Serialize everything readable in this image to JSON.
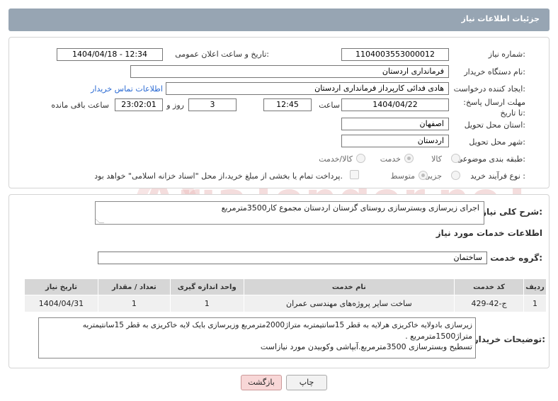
{
  "header": {
    "title": "جزئیات اطلاعات نیاز"
  },
  "fields": {
    "need_number_label": "شماره نیاز:",
    "need_number": "1104003553000012",
    "announce_label": "تاریخ و ساعت اعلان عمومی:",
    "announce_value": "1404/04/18 - 12:34",
    "buyer_org_label": "نام دستگاه خریدار:",
    "buyer_org": "فرمانداری اردستان",
    "creator_label": "ایجاد کننده درخواست:",
    "creator": "هادی فدائی کارپرداز فرمانداری اردستان",
    "contact_link": "اطلاعات تماس خریدار",
    "deadline_label": "مهلت ارسال پاسخ: تا تاریخ:",
    "deadline_date": "1404/04/22",
    "time_label": "ساعت",
    "deadline_time": "12:45",
    "days_value": "3",
    "days_label": "روز و",
    "remaining_time": "23:02:01",
    "remaining_label": "ساعت باقی مانده",
    "province_label": "استان محل تحویل:",
    "province": "اصفهان",
    "city_label": "شهر محل تحویل:",
    "city": "اردستان",
    "category_label": "طبقه بندی موضوعی:",
    "category_options": [
      "کالا",
      "خدمت",
      "کالا/خدمت"
    ],
    "process_label": "نوع فرآیند خرید :",
    "process_options": [
      "جزیی",
      "متوسط"
    ],
    "payment_note": "پرداخت تمام یا بخشی از مبلغ خرید،از محل \"اسناد خزانه اسلامی\" خواهد بود."
  },
  "summary": {
    "label": "شرح کلی نیاز:",
    "text": "اجرای زیرسازی وبسترسازی روستای گزستان اردستان مجموع کار3500مترمربع"
  },
  "services": {
    "title": "اطلاعات خدمات مورد نیاز",
    "group_label": "گروه خدمت:",
    "group_value": "ساختمان",
    "columns": [
      "ردیف",
      "کد خدمت",
      "نام خدمت",
      "واحد اندازه گیری",
      "تعداد / مقدار",
      "تاریخ نیاز"
    ],
    "rows": [
      [
        "1",
        "ج-42-429",
        "ساخت سایر پروژه‌های مهندسی عمران",
        "1",
        "1",
        "1404/04/31"
      ]
    ]
  },
  "buyer_notes": {
    "label": "توضیحات خریدار:",
    "line1": "زیرسازی بادولایه خاکریزی هرلایه به قطر 15سانتیمتربه متراژ2000مترمربع وزیرسازی بایک لایه خاکریزی به قطر 15سانتیمتربه",
    "line2": "متراژ1500مترمربع .",
    "line3": "تسطیح وبسترسازی 3500مترمربع.آبپاشی وکوبیدن مورد نیازاست"
  },
  "buttons": {
    "print": "چاپ",
    "back": "بازگشت"
  },
  "watermark": "AriaTender.neT"
}
